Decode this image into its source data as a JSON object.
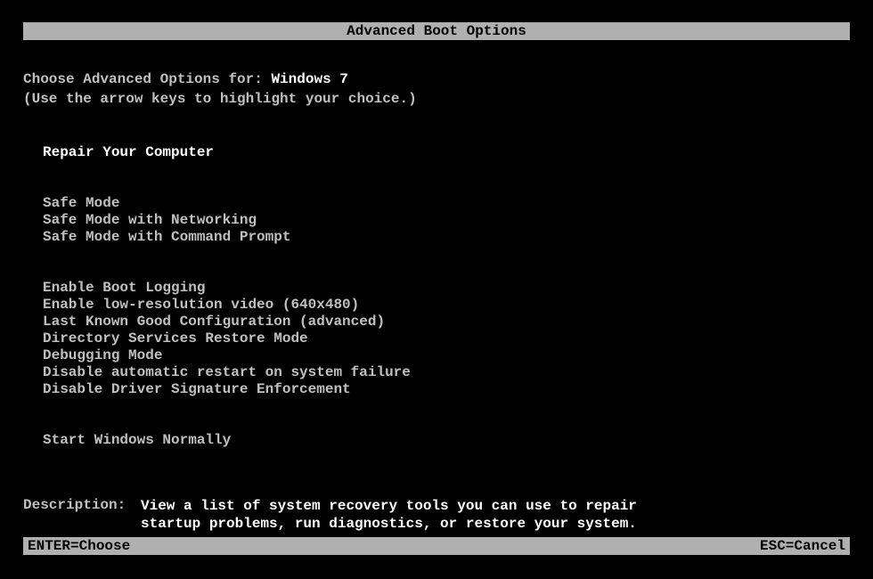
{
  "header": {
    "title": "Advanced Boot Options"
  },
  "prompt": {
    "prefix": "Choose Advanced Options for: ",
    "os": "Windows 7",
    "hint": "(Use the arrow keys to highlight your choice.)"
  },
  "menu": {
    "groups": [
      [
        "Repair Your Computer"
      ],
      [
        "Safe Mode",
        "Safe Mode with Networking",
        "Safe Mode with Command Prompt"
      ],
      [
        "Enable Boot Logging",
        "Enable low-resolution video (640x480)",
        "Last Known Good Configuration (advanced)",
        "Directory Services Restore Mode",
        "Debugging Mode",
        "Disable automatic restart on system failure",
        "Disable Driver Signature Enforcement"
      ],
      [
        "Start Windows Normally"
      ]
    ],
    "selected": "Repair Your Computer"
  },
  "description": {
    "label": "Description:",
    "text": "View a list of system recovery tools you can use to repair startup problems, run diagnostics, or restore your system."
  },
  "footer": {
    "enter": "ENTER=Choose",
    "esc": "ESC=Cancel"
  }
}
